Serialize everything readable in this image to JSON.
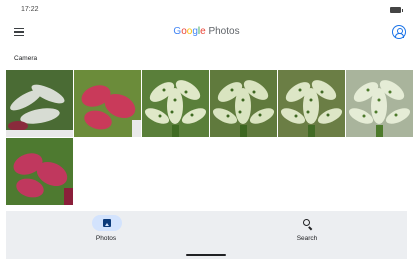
{
  "status_bar": {
    "time": "17:22",
    "battery_icon": "battery-icon"
  },
  "app_bar": {
    "menu_icon": "menu-icon",
    "title_letters": [
      "G",
      "o",
      "o",
      "g",
      "l",
      "e"
    ],
    "title_suffix": " Photos",
    "account_icon": "account-circle-icon"
  },
  "section": {
    "label": "Camera"
  },
  "photos": [
    {
      "kind": "variegated-plant",
      "palette": {
        "bg": "#4a6b34",
        "leaf": "#d7dcd3",
        "accent": "#8a2b3c"
      }
    },
    {
      "kind": "pink-plant",
      "palette": {
        "bg": "#6b8c3a",
        "leaf": "#c93a5a",
        "accent": "#e9e9e9"
      }
    },
    {
      "kind": "speckled-plant",
      "palette": {
        "bg": "#5a7f3a",
        "leaf": "#dfe8c8",
        "accent": "#3f6b22"
      }
    },
    {
      "kind": "speckled-plant",
      "palette": {
        "bg": "#607a3d",
        "leaf": "#d9e4c0",
        "accent": "#3d6620"
      }
    },
    {
      "kind": "speckled-plant",
      "palette": {
        "bg": "#6b7e45",
        "leaf": "#dde6c6",
        "accent": "#426b25"
      }
    },
    {
      "kind": "speckled-plant",
      "palette": {
        "bg": "#a9b49c",
        "leaf": "#e5ecd6",
        "accent": "#4d7a2b"
      }
    },
    {
      "kind": "pink-plant",
      "palette": {
        "bg": "#4e7a30",
        "leaf": "#c0385e",
        "accent": "#8a1f3a"
      }
    }
  ],
  "bottom_nav": {
    "items": [
      {
        "label": "Photos",
        "icon": "photos-icon",
        "selected": true
      },
      {
        "label": "Search",
        "icon": "search-icon",
        "selected": false
      }
    ]
  },
  "colors": {
    "google_blue": "#4285F4",
    "google_red": "#EA4335",
    "google_yellow": "#FBBC05",
    "google_green": "#34A853",
    "nav_background": "#eceef1",
    "nav_selected_pill": "#d3e3fd",
    "account_icon": "#1a73e8"
  }
}
